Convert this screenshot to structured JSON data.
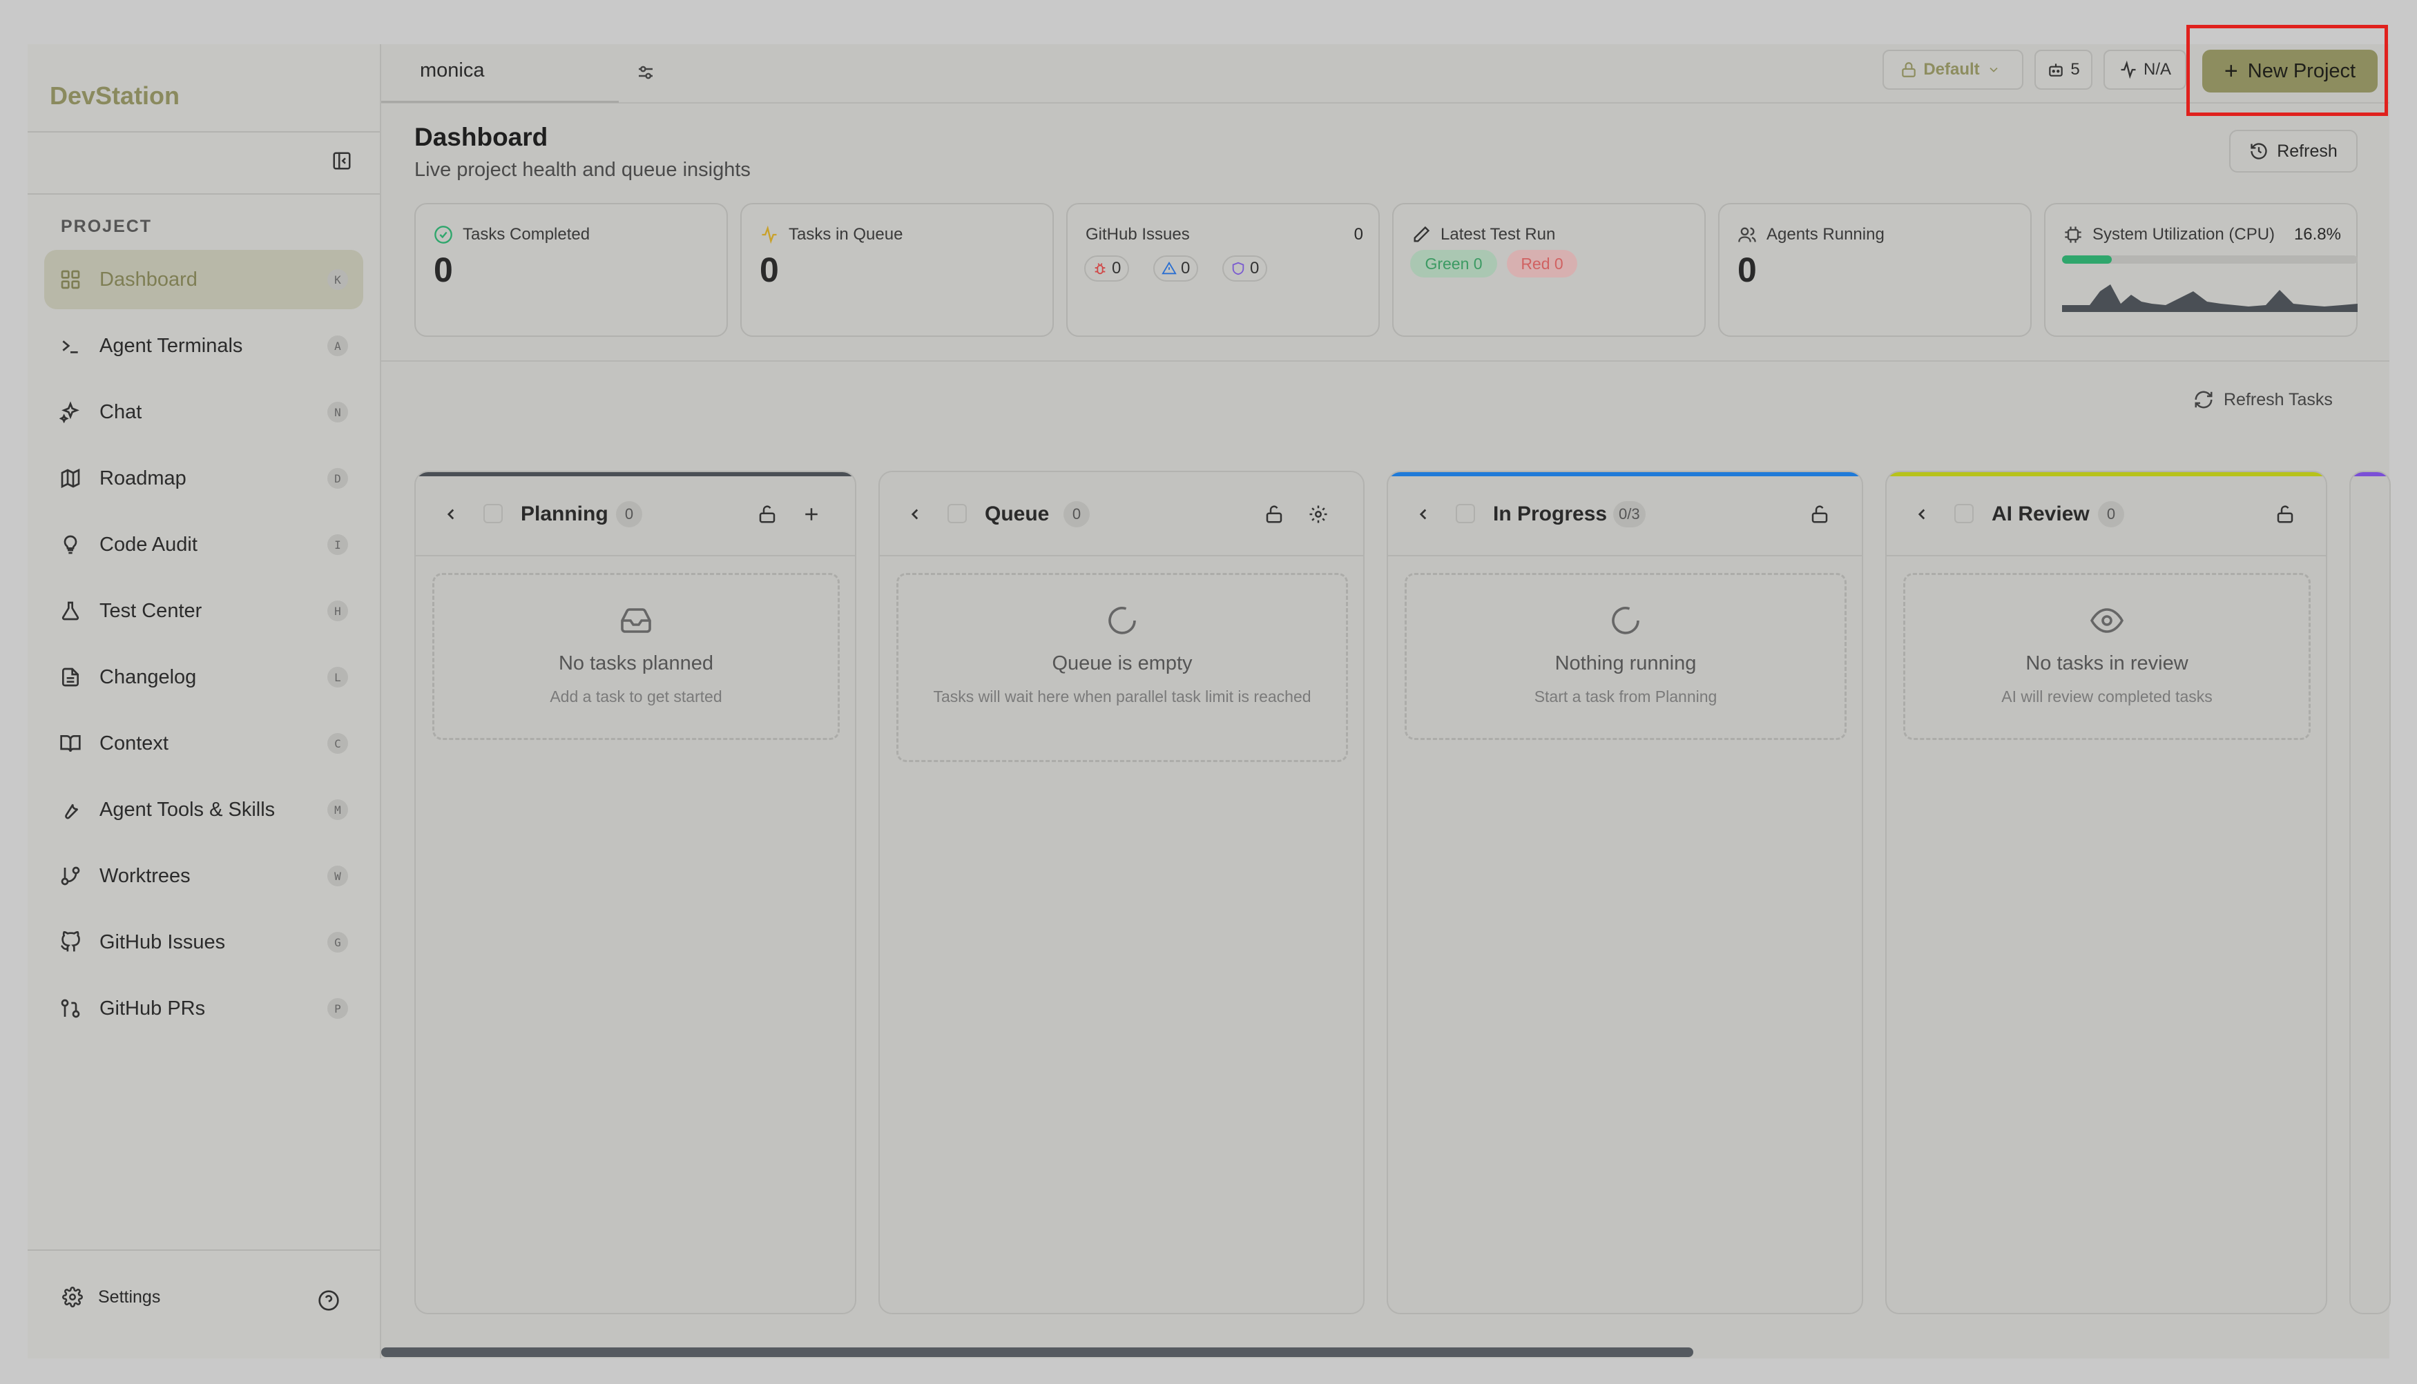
{
  "app": {
    "brand": "DevStation"
  },
  "sidebar": {
    "section_label": "PROJECT",
    "items": [
      {
        "label": "Dashboard",
        "key": "K",
        "icon": "grid-icon",
        "active": true
      },
      {
        "label": "Agent Terminals",
        "key": "A",
        "icon": "terminal-icon"
      },
      {
        "label": "Chat",
        "key": "N",
        "icon": "sparkles-icon"
      },
      {
        "label": "Roadmap",
        "key": "D",
        "icon": "map-icon"
      },
      {
        "label": "Code Audit",
        "key": "I",
        "icon": "lightbulb-icon"
      },
      {
        "label": "Test Center",
        "key": "H",
        "icon": "flask-icon"
      },
      {
        "label": "Changelog",
        "key": "L",
        "icon": "file-text-icon"
      },
      {
        "label": "Context",
        "key": "C",
        "icon": "book-icon"
      },
      {
        "label": "Agent Tools & Skills",
        "key": "M",
        "icon": "wrench-icon"
      },
      {
        "label": "Worktrees",
        "key": "W",
        "icon": "git-branch-icon"
      },
      {
        "label": "GitHub Issues",
        "key": "G",
        "icon": "github-icon"
      },
      {
        "label": "GitHub PRs",
        "key": "P",
        "icon": "git-pull-request-icon"
      }
    ],
    "settings_label": "Settings"
  },
  "topbar": {
    "tab_label": "monica",
    "profile_chip": "Default",
    "agents_chip": "5",
    "activity_chip": "N/A",
    "new_project_label": "New Project"
  },
  "dashboard": {
    "title": "Dashboard",
    "subtitle": "Live project health and queue insights",
    "refresh_label": "Refresh",
    "refresh_tasks_label": "Refresh Tasks"
  },
  "stats": {
    "tasks_completed": {
      "label": "Tasks Completed",
      "value": "0"
    },
    "tasks_in_queue": {
      "label": "Tasks in Queue",
      "value": "0"
    },
    "github_issues": {
      "label": "GitHub Issues",
      "total": "0",
      "bugs": "0",
      "warnings": "0",
      "other": "0"
    },
    "latest_test_run": {
      "label": "Latest Test Run",
      "green": "Green 0",
      "red": "Red 0"
    },
    "agents_running": {
      "label": "Agents Running",
      "value": "0"
    },
    "cpu": {
      "label": "System Utilization (CPU)",
      "value": "16.8%",
      "fraction": 0.168
    }
  },
  "columns": [
    {
      "title": "Planning",
      "count": "0",
      "empty_title": "No tasks planned",
      "empty_sub": "Add a task to get started"
    },
    {
      "title": "Queue",
      "count": "0",
      "empty_title": "Queue is empty",
      "empty_sub": "Tasks will wait here when parallel task limit is reached"
    },
    {
      "title": "In Progress",
      "count": "0/3",
      "empty_title": "Nothing running",
      "empty_sub": "Start a task from Planning"
    },
    {
      "title": "AI Review",
      "count": "0",
      "empty_title": "No tasks in review",
      "empty_sub": "AI will review completed tasks"
    }
  ],
  "colors": {
    "accent": "#8d8d5f",
    "highlight": "#e0211d",
    "progress_top": "#1f7ad8",
    "review_top": "#b7c21a",
    "cpu_bar": "#2fa66c"
  }
}
